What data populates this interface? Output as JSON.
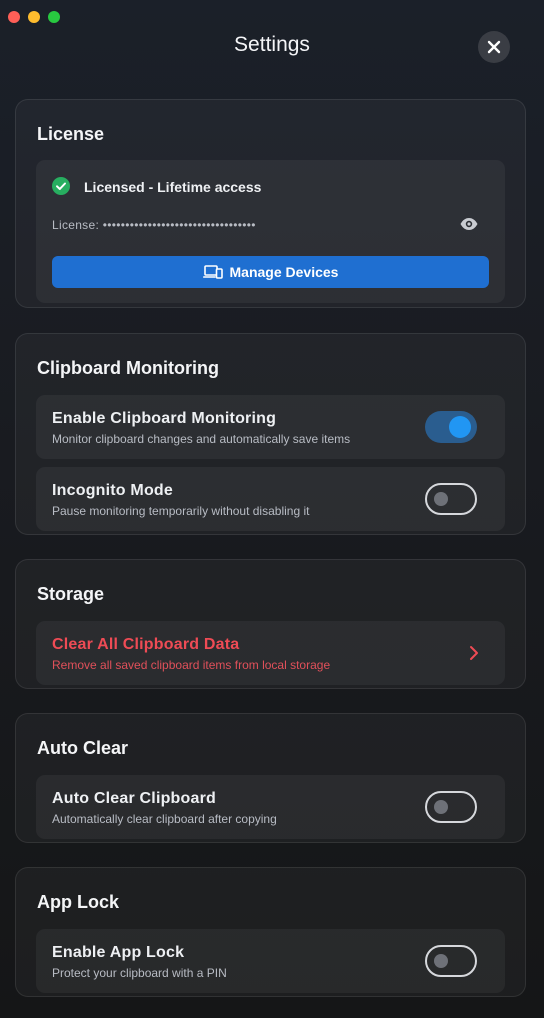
{
  "window": {
    "title": "Settings"
  },
  "license": {
    "section_title": "License",
    "status_text": "Licensed - Lifetime access",
    "key_label": "License:",
    "key_masked": "••••••••••••••••••••••••••••••••••",
    "manage_devices_label": "Manage Devices"
  },
  "clipboard_monitoring": {
    "section_title": "Clipboard Monitoring",
    "enable": {
      "title": "Enable Clipboard Monitoring",
      "subtitle": "Monitor clipboard changes and automatically save items",
      "enabled": true
    },
    "incognito": {
      "title": "Incognito Mode",
      "subtitle": "Pause monitoring temporarily without disabling it",
      "enabled": false
    }
  },
  "storage": {
    "section_title": "Storage",
    "clear": {
      "title": "Clear All Clipboard Data",
      "subtitle": "Remove all saved clipboard items from local storage"
    }
  },
  "auto_clear": {
    "section_title": "Auto Clear",
    "clipboard": {
      "title": "Auto Clear Clipboard",
      "subtitle": "Automatically clear clipboard after copying",
      "enabled": false
    }
  },
  "app_lock": {
    "section_title": "App Lock",
    "enable": {
      "title": "Enable App Lock",
      "subtitle": "Protect your clipboard with a PIN",
      "enabled": false
    }
  },
  "colors": {
    "accent": "#1f6fd1",
    "toggle_on": "#2196f3",
    "success": "#27ae60",
    "danger": "#ef4b55"
  },
  "icons": {
    "close": "close-icon",
    "check": "check-circle-icon",
    "eye": "eye-icon",
    "devices": "devices-icon",
    "chevron": "chevron-right-icon"
  }
}
